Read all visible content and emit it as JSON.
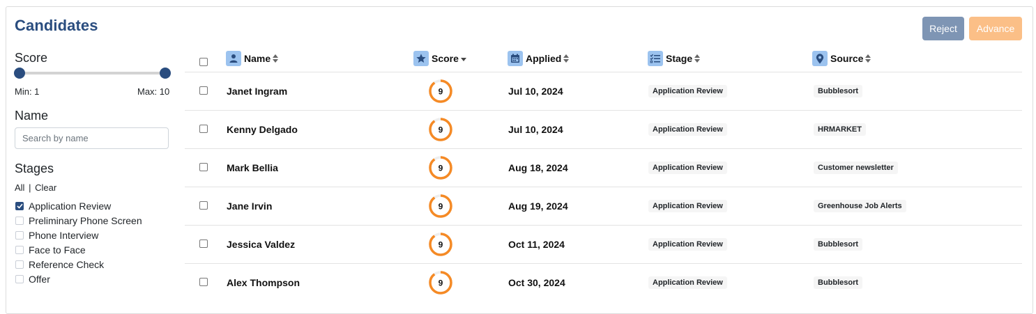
{
  "page": {
    "title": "Candidates",
    "reject_label": "Reject",
    "advance_label": "Advance"
  },
  "colors": {
    "primary": "#2a4d7f",
    "reject": "#7e95b4",
    "advance": "#fbbf87",
    "header_icon_bg": "#9cc3ef",
    "score_ring": "#f58a25"
  },
  "filters": {
    "score": {
      "heading": "Score",
      "min_label": "Min: 1",
      "max_label": "Max: 10"
    },
    "name": {
      "heading": "Name",
      "placeholder": "Search by name"
    },
    "stages": {
      "heading": "Stages",
      "all_label": "All",
      "separator": "|",
      "clear_label": "Clear",
      "items": [
        {
          "label": "Application Review",
          "checked": true
        },
        {
          "label": "Preliminary Phone Screen",
          "checked": false
        },
        {
          "label": "Phone Interview",
          "checked": false
        },
        {
          "label": "Face to Face",
          "checked": false
        },
        {
          "label": "Reference Check",
          "checked": false
        },
        {
          "label": "Offer",
          "checked": false
        }
      ]
    }
  },
  "table": {
    "columns": {
      "name": {
        "label": "Name",
        "icon": "person-icon"
      },
      "score": {
        "label": "Score",
        "icon": "star-icon"
      },
      "applied": {
        "label": "Applied",
        "icon": "calendar-icon"
      },
      "stage": {
        "label": "Stage",
        "icon": "checklist-icon"
      },
      "source": {
        "label": "Source",
        "icon": "location-pin-icon"
      }
    },
    "rows": [
      {
        "name": "Janet Ingram",
        "score": "9",
        "applied": "Jul 10, 2024",
        "stage": "Application Review",
        "source": "Bubblesort"
      },
      {
        "name": "Kenny Delgado",
        "score": "9",
        "applied": "Jul 10, 2024",
        "stage": "Application Review",
        "source": "HRMARKET"
      },
      {
        "name": "Mark Bellia",
        "score": "9",
        "applied": "Aug 18, 2024",
        "stage": "Application Review",
        "source": "Customer newsletter"
      },
      {
        "name": "Jane Irvin",
        "score": "9",
        "applied": "Aug 19, 2024",
        "stage": "Application Review",
        "source": "Greenhouse Job Alerts"
      },
      {
        "name": "Jessica Valdez",
        "score": "9",
        "applied": "Oct 11, 2024",
        "stage": "Application Review",
        "source": "Bubblesort"
      },
      {
        "name": "Alex Thompson",
        "score": "9",
        "applied": "Oct 30, 2024",
        "stage": "Application Review",
        "source": "Bubblesort"
      }
    ]
  }
}
